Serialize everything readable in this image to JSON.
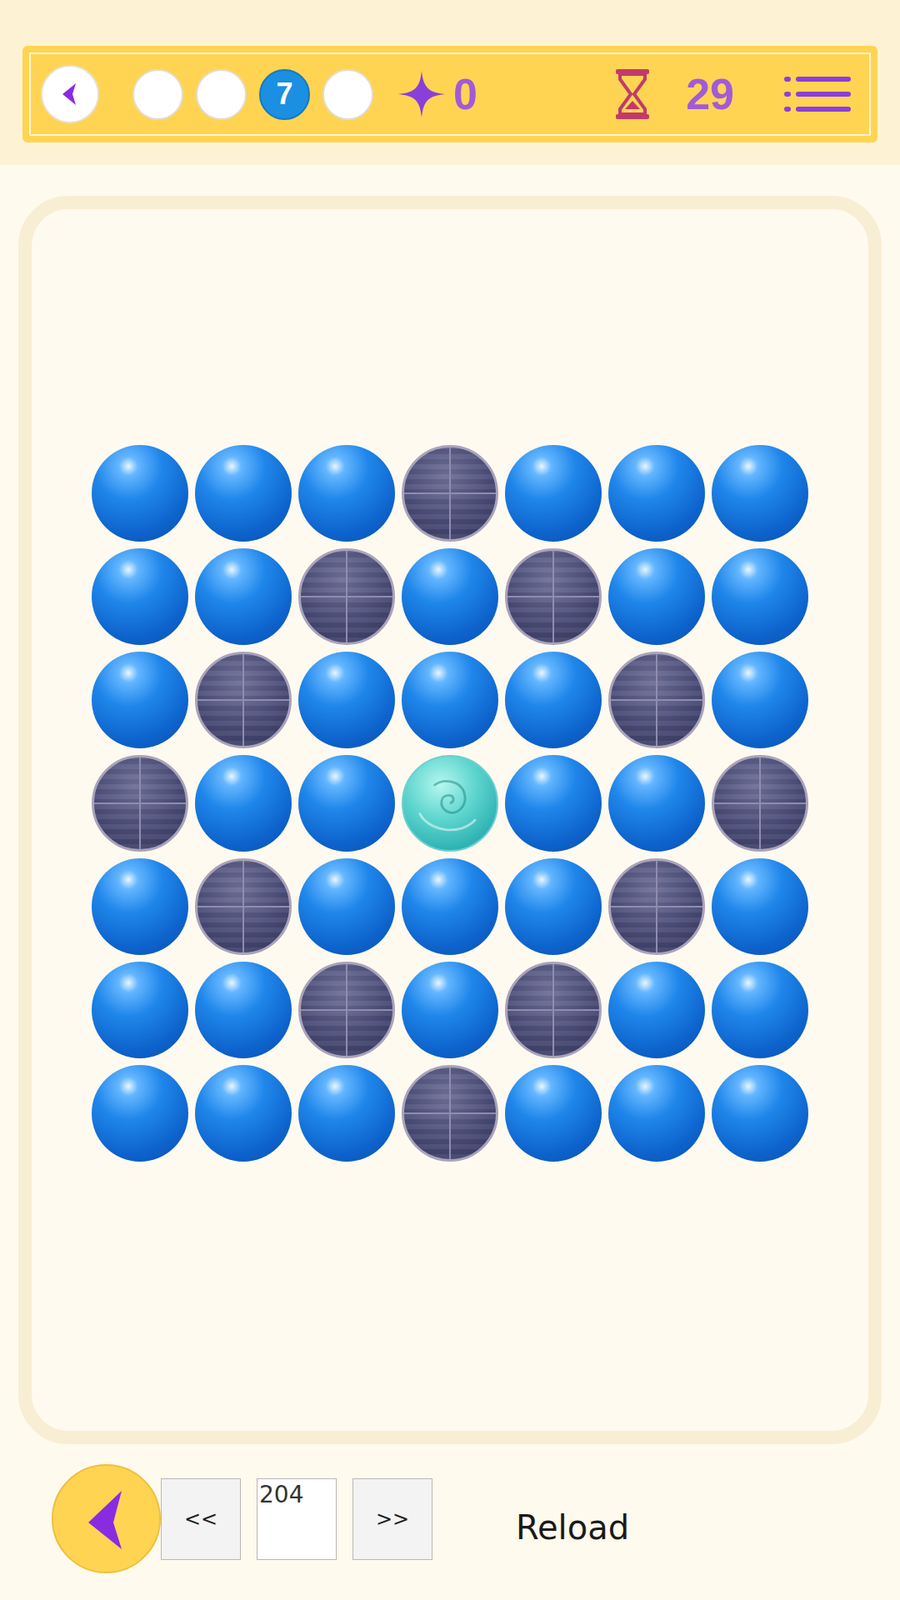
{
  "header": {
    "levels": [
      {
        "label": "",
        "selected": false
      },
      {
        "label": "",
        "selected": false
      },
      {
        "label": "7",
        "selected": true
      },
      {
        "label": "",
        "selected": false
      }
    ],
    "stars": "0",
    "timer": "29"
  },
  "board": {
    "rows": [
      [
        "blue",
        "blue",
        "blue",
        "stone",
        "blue",
        "blue",
        "blue"
      ],
      [
        "blue",
        "blue",
        "stone",
        "blue",
        "stone",
        "blue",
        "blue"
      ],
      [
        "blue",
        "stone",
        "blue",
        "blue",
        "blue",
        "stone",
        "blue"
      ],
      [
        "stone",
        "blue",
        "blue",
        "gem",
        "blue",
        "blue",
        "stone"
      ],
      [
        "blue",
        "stone",
        "blue",
        "blue",
        "blue",
        "stone",
        "blue"
      ],
      [
        "blue",
        "blue",
        "stone",
        "blue",
        "stone",
        "blue",
        "blue"
      ],
      [
        "blue",
        "blue",
        "blue",
        "stone",
        "blue",
        "blue",
        "blue"
      ]
    ]
  },
  "footer": {
    "prev": "<<",
    "page": "204",
    "next": ">>",
    "reload": "Reload"
  }
}
